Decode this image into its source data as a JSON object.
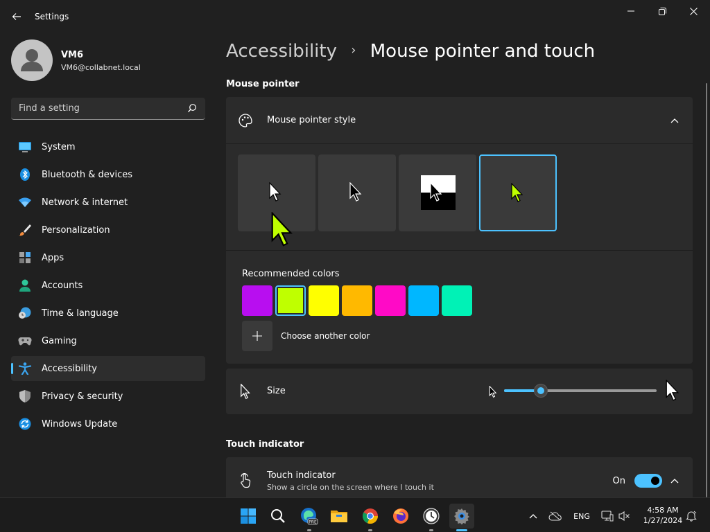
{
  "window": {
    "app_title": "Settings"
  },
  "user": {
    "name": "VM6",
    "email": "VM6@collabnet.local"
  },
  "search": {
    "placeholder": "Find a setting",
    "value": ""
  },
  "nav": {
    "items": [
      {
        "label": "System",
        "icon": "system-icon"
      },
      {
        "label": "Bluetooth & devices",
        "icon": "bluetooth-icon"
      },
      {
        "label": "Network & internet",
        "icon": "wifi-icon"
      },
      {
        "label": "Personalization",
        "icon": "brush-icon"
      },
      {
        "label": "Apps",
        "icon": "apps-icon"
      },
      {
        "label": "Accounts",
        "icon": "accounts-icon"
      },
      {
        "label": "Time & language",
        "icon": "globe-clock-icon"
      },
      {
        "label": "Gaming",
        "icon": "gamepad-icon"
      },
      {
        "label": "Accessibility",
        "icon": "accessibility-icon",
        "active": true
      },
      {
        "label": "Privacy & security",
        "icon": "shield-icon"
      },
      {
        "label": "Windows Update",
        "icon": "update-icon"
      }
    ]
  },
  "breadcrumb": {
    "parent": "Accessibility",
    "separator": "›",
    "current": "Mouse pointer and touch"
  },
  "mouse_pointer": {
    "section_title": "Mouse pointer",
    "style_label": "Mouse pointer style",
    "styles": [
      "white",
      "black",
      "inverted",
      "custom"
    ],
    "selected_style": "custom",
    "recommended_colors_label": "Recommended colors",
    "colors": [
      "#b80ef0",
      "#bfff00",
      "#ffff00",
      "#ffb900",
      "#ff0ac6",
      "#00b7ff",
      "#00f2b6"
    ],
    "selected_color": "#bfff00",
    "choose_color_label": "Choose another color",
    "size_label": "Size",
    "size_value_fraction": 0.24
  },
  "touch": {
    "section_title": "Touch indicator",
    "label": "Touch indicator",
    "description": "Show a circle on the screen where I touch it",
    "toggle_state": "On"
  },
  "taskbar": {
    "apps": [
      "start-icon",
      "search-icon",
      "edge-pre-icon",
      "file-explorer-icon",
      "chrome-icon",
      "firefox-icon",
      "clock-app-icon",
      "settings-icon"
    ],
    "language": "ENG",
    "time": "4:58 AM",
    "date": "1/27/2024"
  },
  "colors": {
    "accent": "#4cc2ff",
    "background": "#202020",
    "card": "#2b2b2b"
  }
}
